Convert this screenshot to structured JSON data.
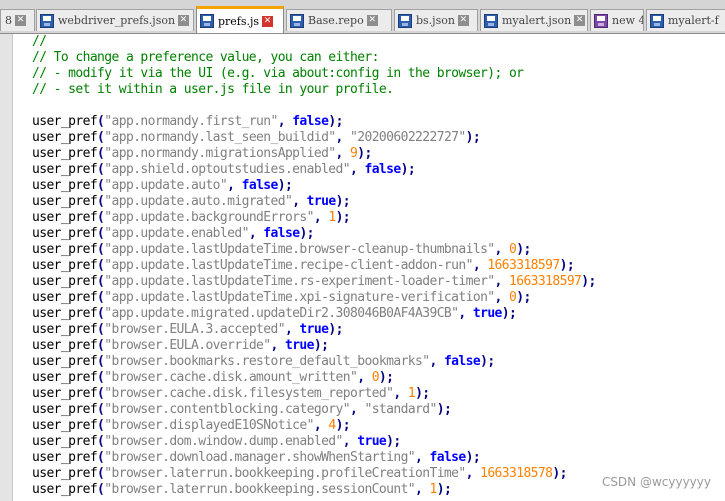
{
  "tabs": [
    {
      "label": "8",
      "icon": "none",
      "active": false
    },
    {
      "label": "webdriver_prefs.json",
      "icon": "save-icon",
      "active": false
    },
    {
      "label": "prefs.js",
      "icon": "save-icon",
      "active": true
    },
    {
      "label": "Base.repo",
      "icon": "save-icon",
      "active": false
    },
    {
      "label": "bs.json",
      "icon": "save-icon",
      "active": false
    },
    {
      "label": "myalert.json",
      "icon": "save-icon",
      "active": false
    },
    {
      "label": "new 4",
      "icon": "save-icon-purple",
      "active": false
    },
    {
      "label": "myalert-f",
      "icon": "save-icon",
      "active": false
    }
  ],
  "colors": {
    "comment": "#008000",
    "string": "#808080",
    "operator": "#000080",
    "boolean": "#0000ff",
    "number": "#ff8000",
    "active_tab_accent": "#f6a400"
  },
  "comments": [
    "//",
    "// To change a preference value, you can either:",
    "// - modify it via the UI (e.g. via about:config in the browser); or",
    "// - set it within a user.js file in your profile."
  ],
  "prefs": [
    {
      "key": "\"app.normandy.first_run\"",
      "value": "false",
      "type": "bool"
    },
    {
      "key": "\"app.normandy.last_seen_buildid\"",
      "value": "\"20200602222727\"",
      "type": "str"
    },
    {
      "key": "\"app.normandy.migrationsApplied\"",
      "value": "9",
      "type": "num"
    },
    {
      "key": "\"app.shield.optoutstudies.enabled\"",
      "value": "false",
      "type": "bool"
    },
    {
      "key": "\"app.update.auto\"",
      "value": "false",
      "type": "bool"
    },
    {
      "key": "\"app.update.auto.migrated\"",
      "value": "true",
      "type": "bool"
    },
    {
      "key": "\"app.update.backgroundErrors\"",
      "value": "1",
      "type": "num"
    },
    {
      "key": "\"app.update.enabled\"",
      "value": "false",
      "type": "bool"
    },
    {
      "key": "\"app.update.lastUpdateTime.browser-cleanup-thumbnails\"",
      "value": "0",
      "type": "num"
    },
    {
      "key": "\"app.update.lastUpdateTime.recipe-client-addon-run\"",
      "value": "1663318597",
      "type": "num"
    },
    {
      "key": "\"app.update.lastUpdateTime.rs-experiment-loader-timer\"",
      "value": "1663318597",
      "type": "num"
    },
    {
      "key": "\"app.update.lastUpdateTime.xpi-signature-verification\"",
      "value": "0",
      "type": "num"
    },
    {
      "key": "\"app.update.migrated.updateDir2.308046B0AF4A39CB\"",
      "value": "true",
      "type": "bool"
    },
    {
      "key": "\"browser.EULA.3.accepted\"",
      "value": "true",
      "type": "bool"
    },
    {
      "key": "\"browser.EULA.override\"",
      "value": "true",
      "type": "bool"
    },
    {
      "key": "\"browser.bookmarks.restore_default_bookmarks\"",
      "value": "false",
      "type": "bool"
    },
    {
      "key": "\"browser.cache.disk.amount_written\"",
      "value": "0",
      "type": "num"
    },
    {
      "key": "\"browser.cache.disk.filesystem_reported\"",
      "value": "1",
      "type": "num"
    },
    {
      "key": "\"browser.contentblocking.category\"",
      "value": "\"standard\"",
      "type": "str"
    },
    {
      "key": "\"browser.displayedE10SNotice\"",
      "value": "4",
      "type": "num"
    },
    {
      "key": "\"browser.dom.window.dump.enabled\"",
      "value": "true",
      "type": "bool"
    },
    {
      "key": "\"browser.download.manager.showWhenStarting\"",
      "value": "false",
      "type": "bool"
    },
    {
      "key": "\"browser.laterrun.bookkeeping.profileCreationTime\"",
      "value": "1663318578",
      "type": "num"
    },
    {
      "key": "\"browser.laterrun.bookkeeping.sessionCount\"",
      "value": "1",
      "type": "num"
    }
  ],
  "syntax": {
    "fn_name": "user_pref",
    "open": "(",
    "sep": ", ",
    "close": ");"
  },
  "watermark": "CSDN @wcyyyyyy"
}
